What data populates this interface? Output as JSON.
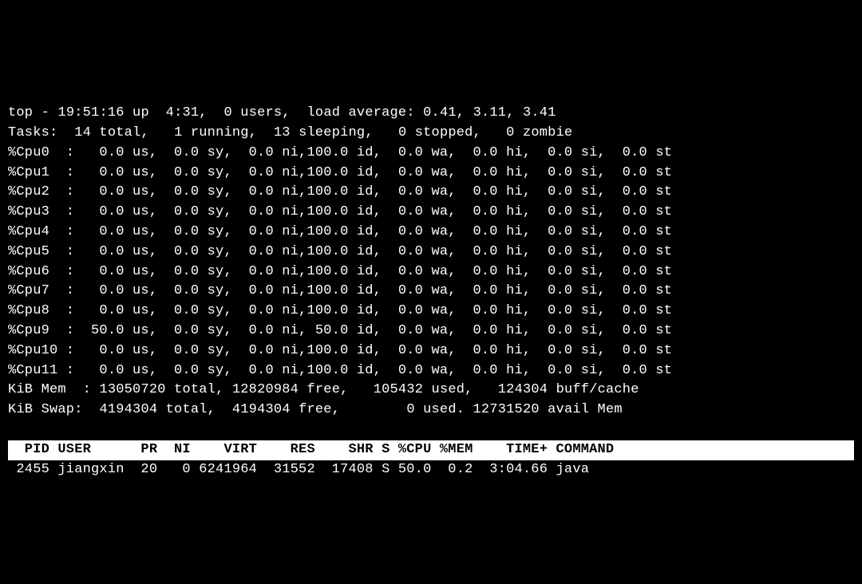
{
  "summary": {
    "program": "top",
    "time": "19:51:16",
    "uptime": "4:31",
    "users": "0 users",
    "load_avg_1": "0.41",
    "load_avg_5": "3.11",
    "load_avg_15": "3.41"
  },
  "tasks": {
    "total": "14",
    "running": "1",
    "sleeping": "13",
    "stopped": "0",
    "zombie": "0"
  },
  "cpus": [
    {
      "label": "%Cpu0",
      "us": "0.0",
      "sy": "0.0",
      "ni": "0.0",
      "id": "100.0",
      "wa": "0.0",
      "hi": "0.0",
      "si": "0.0",
      "st": "0.0"
    },
    {
      "label": "%Cpu1",
      "us": "0.0",
      "sy": "0.0",
      "ni": "0.0",
      "id": "100.0",
      "wa": "0.0",
      "hi": "0.0",
      "si": "0.0",
      "st": "0.0"
    },
    {
      "label": "%Cpu2",
      "us": "0.0",
      "sy": "0.0",
      "ni": "0.0",
      "id": "100.0",
      "wa": "0.0",
      "hi": "0.0",
      "si": "0.0",
      "st": "0.0"
    },
    {
      "label": "%Cpu3",
      "us": "0.0",
      "sy": "0.0",
      "ni": "0.0",
      "id": "100.0",
      "wa": "0.0",
      "hi": "0.0",
      "si": "0.0",
      "st": "0.0"
    },
    {
      "label": "%Cpu4",
      "us": "0.0",
      "sy": "0.0",
      "ni": "0.0",
      "id": "100.0",
      "wa": "0.0",
      "hi": "0.0",
      "si": "0.0",
      "st": "0.0"
    },
    {
      "label": "%Cpu5",
      "us": "0.0",
      "sy": "0.0",
      "ni": "0.0",
      "id": "100.0",
      "wa": "0.0",
      "hi": "0.0",
      "si": "0.0",
      "st": "0.0"
    },
    {
      "label": "%Cpu6",
      "us": "0.0",
      "sy": "0.0",
      "ni": "0.0",
      "id": "100.0",
      "wa": "0.0",
      "hi": "0.0",
      "si": "0.0",
      "st": "0.0"
    },
    {
      "label": "%Cpu7",
      "us": "0.0",
      "sy": "0.0",
      "ni": "0.0",
      "id": "100.0",
      "wa": "0.0",
      "hi": "0.0",
      "si": "0.0",
      "st": "0.0"
    },
    {
      "label": "%Cpu8",
      "us": "0.0",
      "sy": "0.0",
      "ni": "0.0",
      "id": "100.0",
      "wa": "0.0",
      "hi": "0.0",
      "si": "0.0",
      "st": "0.0"
    },
    {
      "label": "%Cpu9",
      "us": "50.0",
      "sy": "0.0",
      "ni": "0.0",
      "id": "50.0",
      "wa": "0.0",
      "hi": "0.0",
      "si": "0.0",
      "st": "0.0"
    },
    {
      "label": "%Cpu10",
      "us": "0.0",
      "sy": "0.0",
      "ni": "0.0",
      "id": "100.0",
      "wa": "0.0",
      "hi": "0.0",
      "si": "0.0",
      "st": "0.0"
    },
    {
      "label": "%Cpu11",
      "us": "0.0",
      "sy": "0.0",
      "ni": "0.0",
      "id": "100.0",
      "wa": "0.0",
      "hi": "0.0",
      "si": "0.0",
      "st": "0.0"
    }
  ],
  "mem": {
    "label": "KiB Mem ",
    "total": "13050720",
    "free": "12820984",
    "used": "105432",
    "buffcache": "124304"
  },
  "swap": {
    "label": "KiB Swap",
    "total": "4194304",
    "free": "4194304",
    "used": "0",
    "avail": "12731520"
  },
  "table": {
    "headers": {
      "pid": "PID",
      "user": "USER",
      "pr": "PR",
      "ni": "NI",
      "virt": "VIRT",
      "res": "RES",
      "shr": "SHR",
      "s": "S",
      "cpu": "%CPU",
      "mem": "%MEM",
      "time": "TIME+",
      "command": "COMMAND"
    },
    "rows": [
      {
        "pid": "2455",
        "user": "jiangxin",
        "pr": "20",
        "ni": "0",
        "virt": "6241964",
        "res": "31552",
        "shr": "17408",
        "s": "S",
        "cpu": "50.0",
        "mem": "0.2",
        "time": "3:04.66",
        "command": "java"
      }
    ]
  }
}
